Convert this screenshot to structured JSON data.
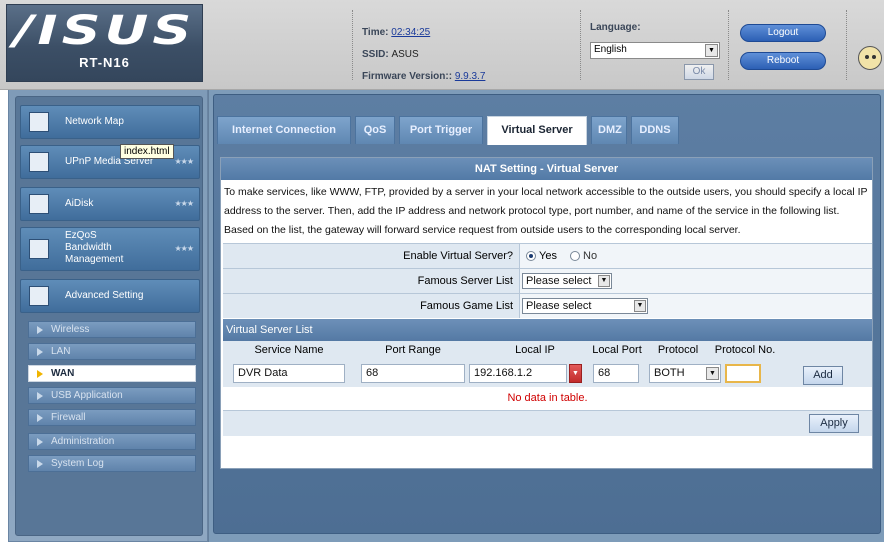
{
  "header": {
    "logo": "/ISUS",
    "model": "RT-N16",
    "time_label": "Time:",
    "time_value": "02:34:25",
    "ssid_label": "SSID:",
    "ssid_value": "ASUS",
    "firmware_label": "Firmware Version::",
    "firmware_value": "9.9.3.7",
    "language_label": "Language:",
    "language_value": "English",
    "ok_label": "Ok",
    "logout_label": "Logout",
    "reboot_label": "Reboot"
  },
  "sidebar": {
    "items": [
      {
        "label": "Network Map"
      },
      {
        "label": "UPnP Media Server"
      },
      {
        "label": "AiDisk"
      },
      {
        "label": "EzQoS\nBandwidth\nManagement",
        "line1": "EzQoS",
        "line2": "Bandwidth",
        "line3": "Management"
      },
      {
        "label": "Advanced Setting"
      }
    ],
    "sub_items": [
      {
        "label": "Wireless"
      },
      {
        "label": "LAN"
      },
      {
        "label": "WAN"
      },
      {
        "label": "USB Application"
      },
      {
        "label": "Firewall"
      },
      {
        "label": "Administration"
      },
      {
        "label": "System Log"
      }
    ],
    "tooltip": "index.html"
  },
  "tabs": [
    {
      "label": "Internet Connection"
    },
    {
      "label": "QoS"
    },
    {
      "label": "Port Trigger"
    },
    {
      "label": "Virtual Server"
    },
    {
      "label": "DMZ"
    },
    {
      "label": "DDNS"
    }
  ],
  "panel": {
    "title": "NAT Setting - Virtual Server",
    "description": "To make services, like WWW, FTP, provided by a server in your local network accessible to the outside users, you should specify a local IP address to the server. Then, add the IP address and network protocol type, port number, and name of the service in the following list. Based on the list, the gateway will forward service request from outside users to the corresponding local server.",
    "enable_label": "Enable Virtual Server?",
    "yes_label": "Yes",
    "no_label": "No",
    "enable_value": "Yes",
    "famous_server_label": "Famous Server List",
    "famous_server_value": "Please select",
    "famous_game_label": "Famous Game List",
    "famous_game_value": "Please select",
    "list_header": "Virtual Server List",
    "columns": [
      "Service Name",
      "Port Range",
      "Local IP",
      "Local Port",
      "Protocol",
      "Protocol No."
    ],
    "inputs": {
      "service_name": "DVR Data",
      "port_range": "68",
      "local_ip": "192.168.1.2",
      "local_port": "68",
      "protocol": "BOTH",
      "protocol_no": ""
    },
    "add_label": "Add",
    "no_data": "No data in table.",
    "apply_label": "Apply"
  }
}
